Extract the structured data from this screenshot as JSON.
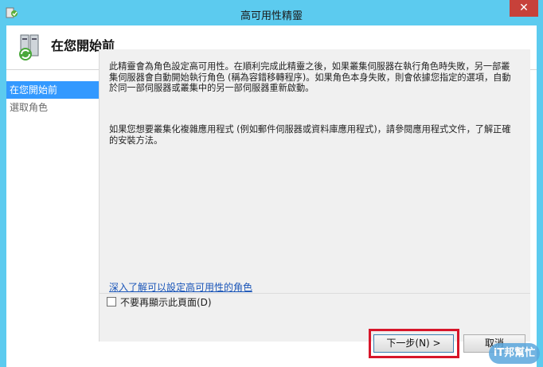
{
  "window": {
    "title": "高可用性精靈",
    "close_glyph": "✕"
  },
  "header": {
    "title": "在您開始前",
    "icon": "cluster-server-icon"
  },
  "nav": {
    "items": [
      {
        "label": "在您開始前",
        "active": true
      },
      {
        "label": "選取角色",
        "active": false
      }
    ]
  },
  "content": {
    "paragraph1": "此精靈會為角色設定高可用性。在順利完成此精靈之後，如果叢集伺服器在執行角色時失敗，另一部叢集伺服器會自動開始執行角色 (稱為容錯移轉程序)。如果角色本身失敗，則會依據您指定的選項，自動於同一部伺服器或叢集中的另一部伺服器重新啟動。",
    "paragraph2": "如果您想要叢集化複雜應用程式 (例如郵件伺服器或資料庫應用程式)，請參閱應用程式文件，了解正確的安裝方法。",
    "link": "深入了解可以設定高可用性的角色",
    "checkbox_label": "不要再顯示此頁面(D)",
    "checkbox_checked": false
  },
  "footer": {
    "next_label": "下一步(N) >",
    "cancel_label": "取消"
  },
  "watermark": {
    "text": "iT邦幫忙"
  },
  "colors": {
    "titlebar": "#5ccbef",
    "close": "#c7413a",
    "nav_active": "#3399ff",
    "highlight": "#d7162a"
  }
}
